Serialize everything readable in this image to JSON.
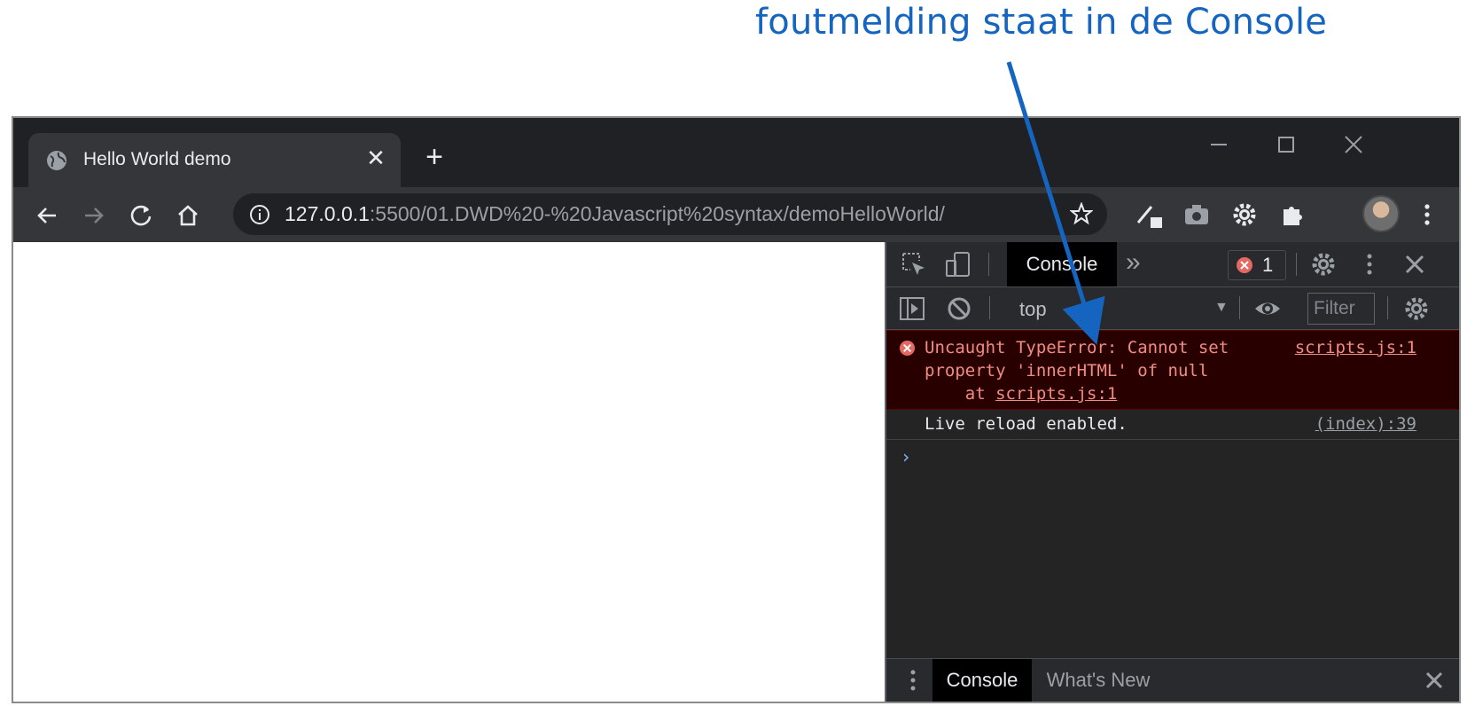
{
  "annotation": {
    "text": "foutmelding staat in de Console",
    "color": "#1565c0"
  },
  "browser": {
    "tab": {
      "title": "Hello World demo",
      "close": "✕"
    },
    "new_tab": "+",
    "url": {
      "host": "127.0.0.1",
      "rest": ":5500/01.DWD%20-%20Javascript%20syntax/demoHelloWorld/"
    }
  },
  "devtools": {
    "panel_tab": "Console",
    "more_tabs": "»",
    "error_count": "1",
    "context": "top",
    "filter_placeholder": "Filter",
    "messages": {
      "error": {
        "line1": "Uncaught TypeError: Cannot set",
        "line2": "property 'innerHTML' of null",
        "line3_prefix": "    at ",
        "line3_link": "scripts.js:1",
        "source": "scripts.js:1"
      },
      "log": {
        "text": "Live reload enabled.",
        "source": "(index):39"
      }
    },
    "prompt": "›",
    "drawer": {
      "tabs": [
        "Console",
        "What's New"
      ],
      "close": "✕"
    }
  },
  "colors": {
    "tab_bg": "#35363a",
    "frame": "#202124",
    "devtools_bg": "#242424",
    "error_text": "#f28b82",
    "error_bg": "#290000"
  }
}
